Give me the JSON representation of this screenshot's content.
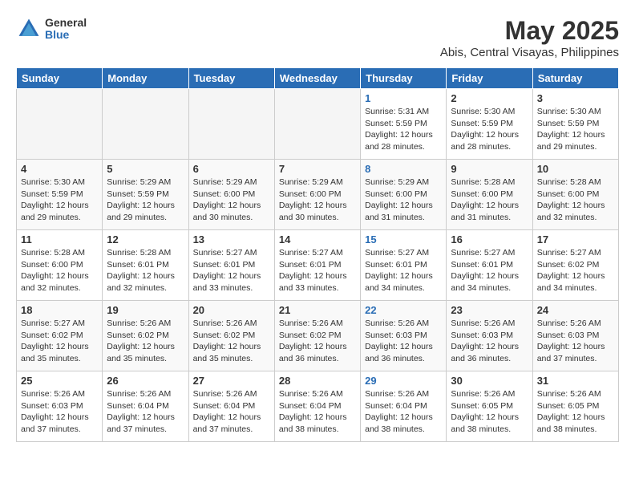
{
  "header": {
    "logo_line1": "General",
    "logo_line2": "Blue",
    "title": "May 2025",
    "subtitle": "Abis, Central Visayas, Philippines"
  },
  "weekdays": [
    "Sunday",
    "Monday",
    "Tuesday",
    "Wednesday",
    "Thursday",
    "Friday",
    "Saturday"
  ],
  "weeks": [
    [
      {
        "day": "",
        "empty": true
      },
      {
        "day": "",
        "empty": true
      },
      {
        "day": "",
        "empty": true
      },
      {
        "day": "",
        "empty": true
      },
      {
        "day": "1",
        "lines": [
          "Sunrise: 5:31 AM",
          "Sunset: 5:59 PM",
          "Daylight: 12 hours",
          "and 28 minutes."
        ]
      },
      {
        "day": "2",
        "lines": [
          "Sunrise: 5:30 AM",
          "Sunset: 5:59 PM",
          "Daylight: 12 hours",
          "and 28 minutes."
        ]
      },
      {
        "day": "3",
        "lines": [
          "Sunrise: 5:30 AM",
          "Sunset: 5:59 PM",
          "Daylight: 12 hours",
          "and 29 minutes."
        ]
      }
    ],
    [
      {
        "day": "4",
        "lines": [
          "Sunrise: 5:30 AM",
          "Sunset: 5:59 PM",
          "Daylight: 12 hours",
          "and 29 minutes."
        ]
      },
      {
        "day": "5",
        "lines": [
          "Sunrise: 5:29 AM",
          "Sunset: 5:59 PM",
          "Daylight: 12 hours",
          "and 29 minutes."
        ]
      },
      {
        "day": "6",
        "lines": [
          "Sunrise: 5:29 AM",
          "Sunset: 6:00 PM",
          "Daylight: 12 hours",
          "and 30 minutes."
        ]
      },
      {
        "day": "7",
        "lines": [
          "Sunrise: 5:29 AM",
          "Sunset: 6:00 PM",
          "Daylight: 12 hours",
          "and 30 minutes."
        ]
      },
      {
        "day": "8",
        "lines": [
          "Sunrise: 5:29 AM",
          "Sunset: 6:00 PM",
          "Daylight: 12 hours",
          "and 31 minutes."
        ]
      },
      {
        "day": "9",
        "lines": [
          "Sunrise: 5:28 AM",
          "Sunset: 6:00 PM",
          "Daylight: 12 hours",
          "and 31 minutes."
        ]
      },
      {
        "day": "10",
        "lines": [
          "Sunrise: 5:28 AM",
          "Sunset: 6:00 PM",
          "Daylight: 12 hours",
          "and 32 minutes."
        ]
      }
    ],
    [
      {
        "day": "11",
        "lines": [
          "Sunrise: 5:28 AM",
          "Sunset: 6:00 PM",
          "Daylight: 12 hours",
          "and 32 minutes."
        ]
      },
      {
        "day": "12",
        "lines": [
          "Sunrise: 5:28 AM",
          "Sunset: 6:01 PM",
          "Daylight: 12 hours",
          "and 32 minutes."
        ]
      },
      {
        "day": "13",
        "lines": [
          "Sunrise: 5:27 AM",
          "Sunset: 6:01 PM",
          "Daylight: 12 hours",
          "and 33 minutes."
        ]
      },
      {
        "day": "14",
        "lines": [
          "Sunrise: 5:27 AM",
          "Sunset: 6:01 PM",
          "Daylight: 12 hours",
          "and 33 minutes."
        ]
      },
      {
        "day": "15",
        "lines": [
          "Sunrise: 5:27 AM",
          "Sunset: 6:01 PM",
          "Daylight: 12 hours",
          "and 34 minutes."
        ]
      },
      {
        "day": "16",
        "lines": [
          "Sunrise: 5:27 AM",
          "Sunset: 6:01 PM",
          "Daylight: 12 hours",
          "and 34 minutes."
        ]
      },
      {
        "day": "17",
        "lines": [
          "Sunrise: 5:27 AM",
          "Sunset: 6:02 PM",
          "Daylight: 12 hours",
          "and 34 minutes."
        ]
      }
    ],
    [
      {
        "day": "18",
        "lines": [
          "Sunrise: 5:27 AM",
          "Sunset: 6:02 PM",
          "Daylight: 12 hours",
          "and 35 minutes."
        ]
      },
      {
        "day": "19",
        "lines": [
          "Sunrise: 5:26 AM",
          "Sunset: 6:02 PM",
          "Daylight: 12 hours",
          "and 35 minutes."
        ]
      },
      {
        "day": "20",
        "lines": [
          "Sunrise: 5:26 AM",
          "Sunset: 6:02 PM",
          "Daylight: 12 hours",
          "and 35 minutes."
        ]
      },
      {
        "day": "21",
        "lines": [
          "Sunrise: 5:26 AM",
          "Sunset: 6:02 PM",
          "Daylight: 12 hours",
          "and 36 minutes."
        ]
      },
      {
        "day": "22",
        "lines": [
          "Sunrise: 5:26 AM",
          "Sunset: 6:03 PM",
          "Daylight: 12 hours",
          "and 36 minutes."
        ]
      },
      {
        "day": "23",
        "lines": [
          "Sunrise: 5:26 AM",
          "Sunset: 6:03 PM",
          "Daylight: 12 hours",
          "and 36 minutes."
        ]
      },
      {
        "day": "24",
        "lines": [
          "Sunrise: 5:26 AM",
          "Sunset: 6:03 PM",
          "Daylight: 12 hours",
          "and 37 minutes."
        ]
      }
    ],
    [
      {
        "day": "25",
        "lines": [
          "Sunrise: 5:26 AM",
          "Sunset: 6:03 PM",
          "Daylight: 12 hours",
          "and 37 minutes."
        ]
      },
      {
        "day": "26",
        "lines": [
          "Sunrise: 5:26 AM",
          "Sunset: 6:04 PM",
          "Daylight: 12 hours",
          "and 37 minutes."
        ]
      },
      {
        "day": "27",
        "lines": [
          "Sunrise: 5:26 AM",
          "Sunset: 6:04 PM",
          "Daylight: 12 hours",
          "and 37 minutes."
        ]
      },
      {
        "day": "28",
        "lines": [
          "Sunrise: 5:26 AM",
          "Sunset: 6:04 PM",
          "Daylight: 12 hours",
          "and 38 minutes."
        ]
      },
      {
        "day": "29",
        "lines": [
          "Sunrise: 5:26 AM",
          "Sunset: 6:04 PM",
          "Daylight: 12 hours",
          "and 38 minutes."
        ]
      },
      {
        "day": "30",
        "lines": [
          "Sunrise: 5:26 AM",
          "Sunset: 6:05 PM",
          "Daylight: 12 hours",
          "and 38 minutes."
        ]
      },
      {
        "day": "31",
        "lines": [
          "Sunrise: 5:26 AM",
          "Sunset: 6:05 PM",
          "Daylight: 12 hours",
          "and 38 minutes."
        ]
      }
    ]
  ]
}
